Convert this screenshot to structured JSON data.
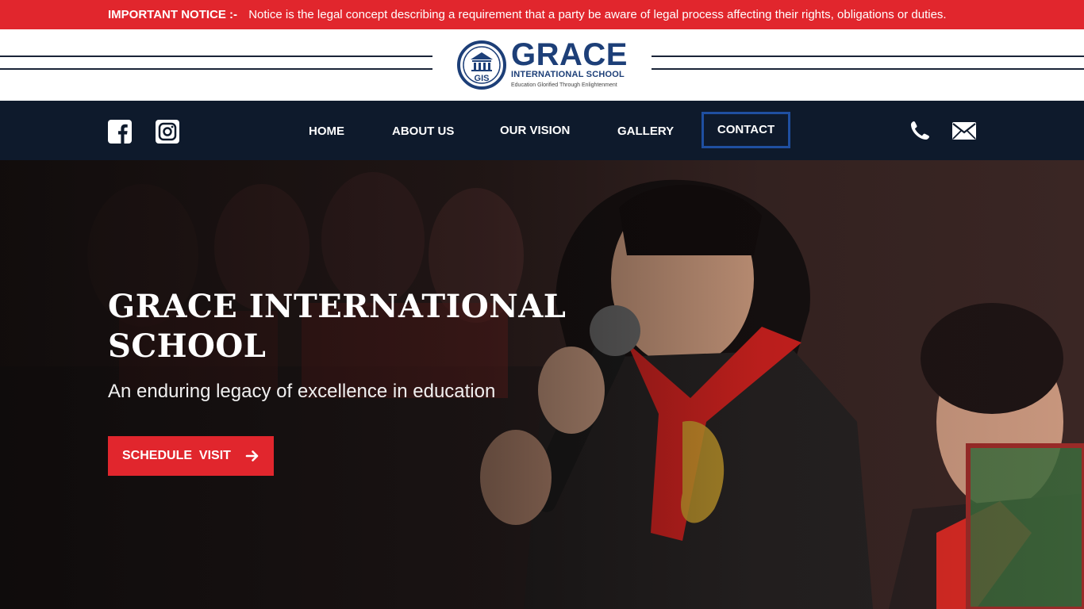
{
  "notice": {
    "label": "IMPORTANT NOTICE :-",
    "text": "Notice is the legal concept describing a requirement that a party be aware of legal process affecting their rights, obligations or duties."
  },
  "logo": {
    "emblem_text": "GIS",
    "brand": "GRACE",
    "subtitle": "INTERNATIONAL SCHOOL",
    "tagline": "Education Glorified Through Enlightenment"
  },
  "nav": {
    "items": [
      {
        "label": "HOME"
      },
      {
        "label": "ABOUT US"
      },
      {
        "label": "OUR VISION"
      },
      {
        "label": "GALLERY"
      },
      {
        "label": "CONTACT"
      }
    ],
    "active": "CONTACT"
  },
  "hero": {
    "title": "GRACE INTERNATIONAL SCHOOL",
    "subtitle": "An enduring legacy of excellence in education",
    "cta_label": "SCHEDULE  VISIT"
  },
  "icons": {
    "social": [
      "facebook-icon",
      "instagram-icon"
    ],
    "contact": [
      "phone-icon",
      "email-icon"
    ],
    "cta": "arrow-right-icon"
  },
  "colors": {
    "notice_bg": "#e1262d",
    "navbar_bg": "#0e1a2c",
    "brand_blue": "#1d3f78",
    "cta_bg": "#e1262d",
    "active_border": "#1f4fa0"
  }
}
